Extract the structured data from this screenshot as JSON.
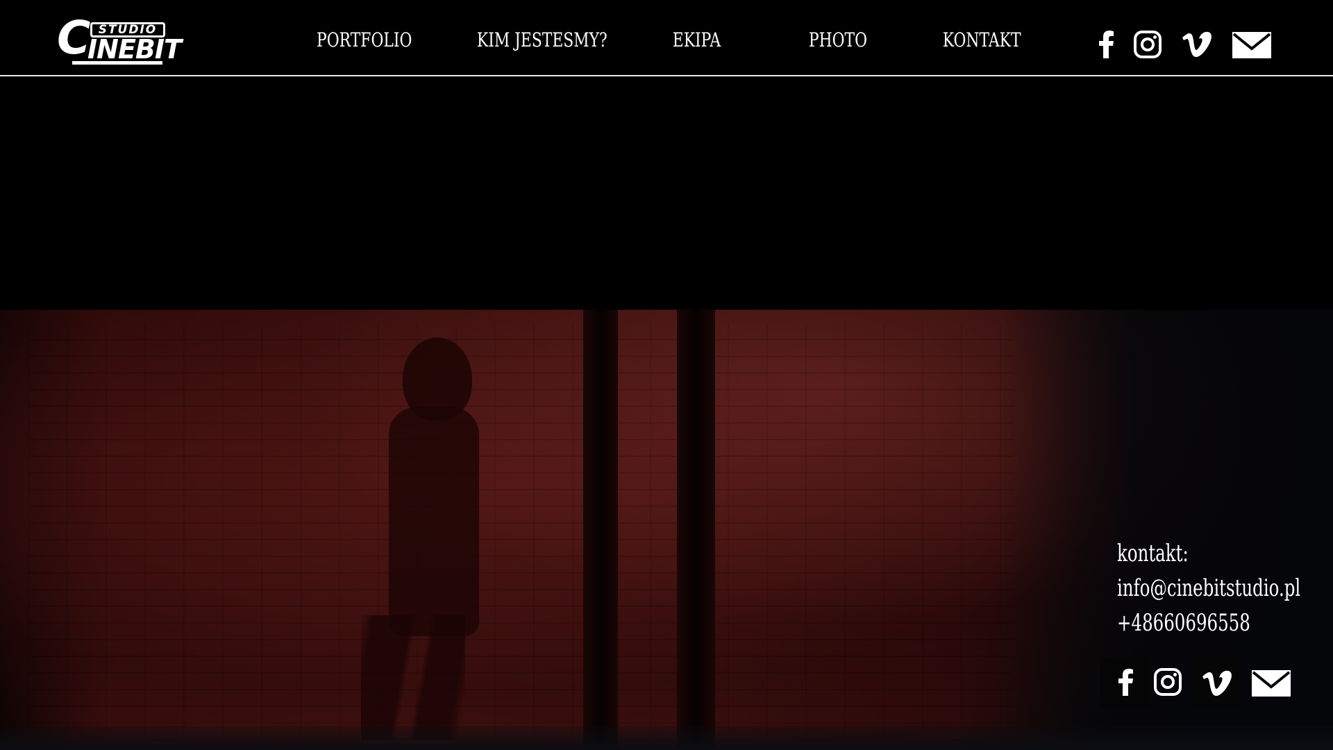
{
  "brand": {
    "logo_top": "STUDIO",
    "logo_c": "C",
    "logo_main": "INEBIT"
  },
  "nav": {
    "items": [
      {
        "label": "PORTFOLIO"
      },
      {
        "label": "KIM JESTESMY?"
      },
      {
        "label": "EKIPA"
      },
      {
        "label": "PHOTO"
      },
      {
        "label": "KONTAKT"
      }
    ]
  },
  "header_social": [
    "facebook-icon",
    "instagram-icon",
    "vimeo-icon",
    "mail-icon"
  ],
  "hero": {
    "description_icon": "photo-woman-silhouette-red-brick-room"
  },
  "contact": {
    "label": "kontakt:",
    "email": "info@cinebitstudio.pl",
    "phone": "+48660696558"
  },
  "footer_social": [
    "facebook-icon",
    "instagram-icon",
    "vimeo-icon",
    "mail-icon"
  ],
  "colors": {
    "background": "#000000",
    "text": "#ffffff",
    "accent_red": "#451311"
  }
}
